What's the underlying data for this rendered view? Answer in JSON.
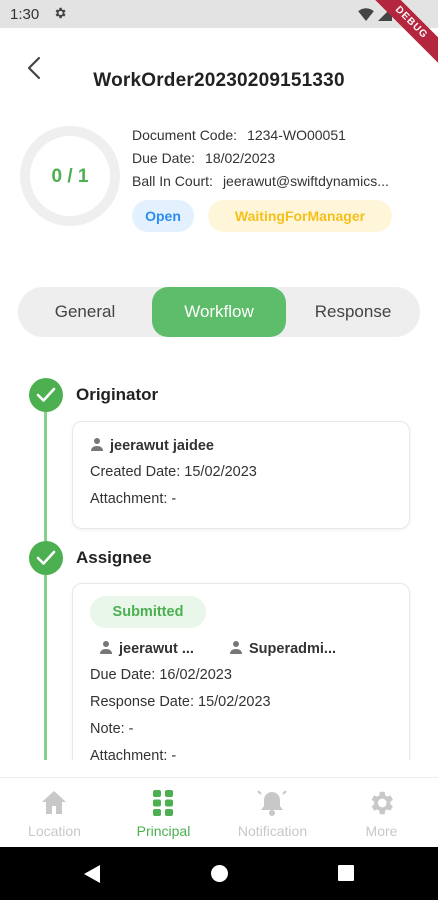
{
  "status_bar": {
    "time": "1:30",
    "debug_label": "DEBUG"
  },
  "header": {
    "title": "WorkOrder20230209151330"
  },
  "progress": {
    "label": "0 / 1",
    "completed": 0,
    "total": 1
  },
  "info": {
    "document_code_label": "Document Code:",
    "document_code": "1234-WO00051",
    "due_date_label": "Due Date:",
    "due_date": "18/02/2023",
    "ball_in_court_label": "Ball In Court:",
    "ball_in_court": "jeerawut@swiftdynamics..."
  },
  "badges": {
    "status": "Open",
    "stage": "WaitingForManager"
  },
  "tabs": {
    "general": "General",
    "workflow": "Workflow",
    "response": "Response",
    "active": "Workflow"
  },
  "workflow": {
    "originator": {
      "title": "Originator",
      "user": "jeerawut jaidee",
      "created_date": "Created Date: 15/02/2023",
      "attachment": "Attachment: -"
    },
    "assignee": {
      "title": "Assignee",
      "status": "Submitted",
      "user_1": "jeerawut ...",
      "user_2": "Superadmi...",
      "due_date": "Due Date: 16/02/2023",
      "response_date": "Response Date: 15/02/2023",
      "note": "Note: -",
      "attachment": "Attachment: -"
    }
  },
  "bottom_nav": {
    "items": [
      {
        "label": "Location",
        "icon": "home-icon"
      },
      {
        "label": "Principal",
        "icon": "grid-icon"
      },
      {
        "label": "Notification",
        "icon": "bell-icon"
      },
      {
        "label": "More",
        "icon": "gear-icon"
      }
    ],
    "active": "Principal"
  },
  "colors": {
    "accent_green": "#4caf50",
    "tab_active": "#5dbd6a",
    "open_blue": "#2d8cf0",
    "waiting_yellow": "#f5c01b"
  }
}
